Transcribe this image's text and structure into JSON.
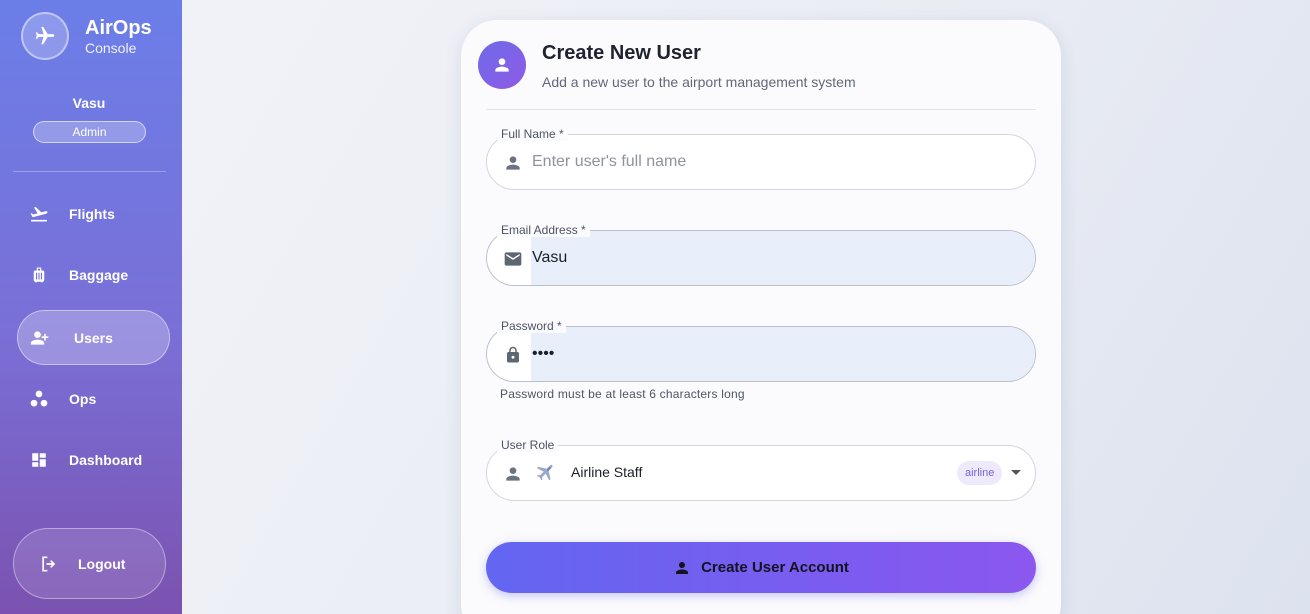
{
  "sidebar": {
    "brand": {
      "title": "AirOps",
      "subtitle": "Console",
      "icon": "airplane-icon"
    },
    "user": {
      "name": "Vasu",
      "role": "Admin"
    },
    "nav": [
      {
        "label": "Flights",
        "icon": "flight-takeoff-icon",
        "active": false
      },
      {
        "label": "Baggage",
        "icon": "luggage-icon",
        "active": false
      },
      {
        "label": "Users",
        "icon": "group-add-icon",
        "active": true
      },
      {
        "label": "Ops",
        "icon": "workspaces-icon",
        "active": false
      },
      {
        "label": "Dashboard",
        "icon": "dashboard-icon",
        "active": false
      }
    ],
    "logout_label": "Logout"
  },
  "form": {
    "title": "Create New User",
    "subtitle": "Add a new user to the airport management system",
    "full_name": {
      "label": "Full Name *",
      "placeholder": "Enter user's full name",
      "value": ""
    },
    "email": {
      "label": "Email Address *",
      "value": "Vasu"
    },
    "password": {
      "label": "Password *",
      "value": "vasu",
      "helper": "Password must be at least 6 characters long"
    },
    "role": {
      "label": "User Role",
      "value": "Airline Staff",
      "chip": "airline"
    },
    "submit_label": "Create User Account"
  },
  "colors": {
    "accent": "#6366f1",
    "accent_end": "#8b57ef",
    "sidebar_top": "#6b7ee8",
    "sidebar_bottom": "#7b52b0"
  }
}
